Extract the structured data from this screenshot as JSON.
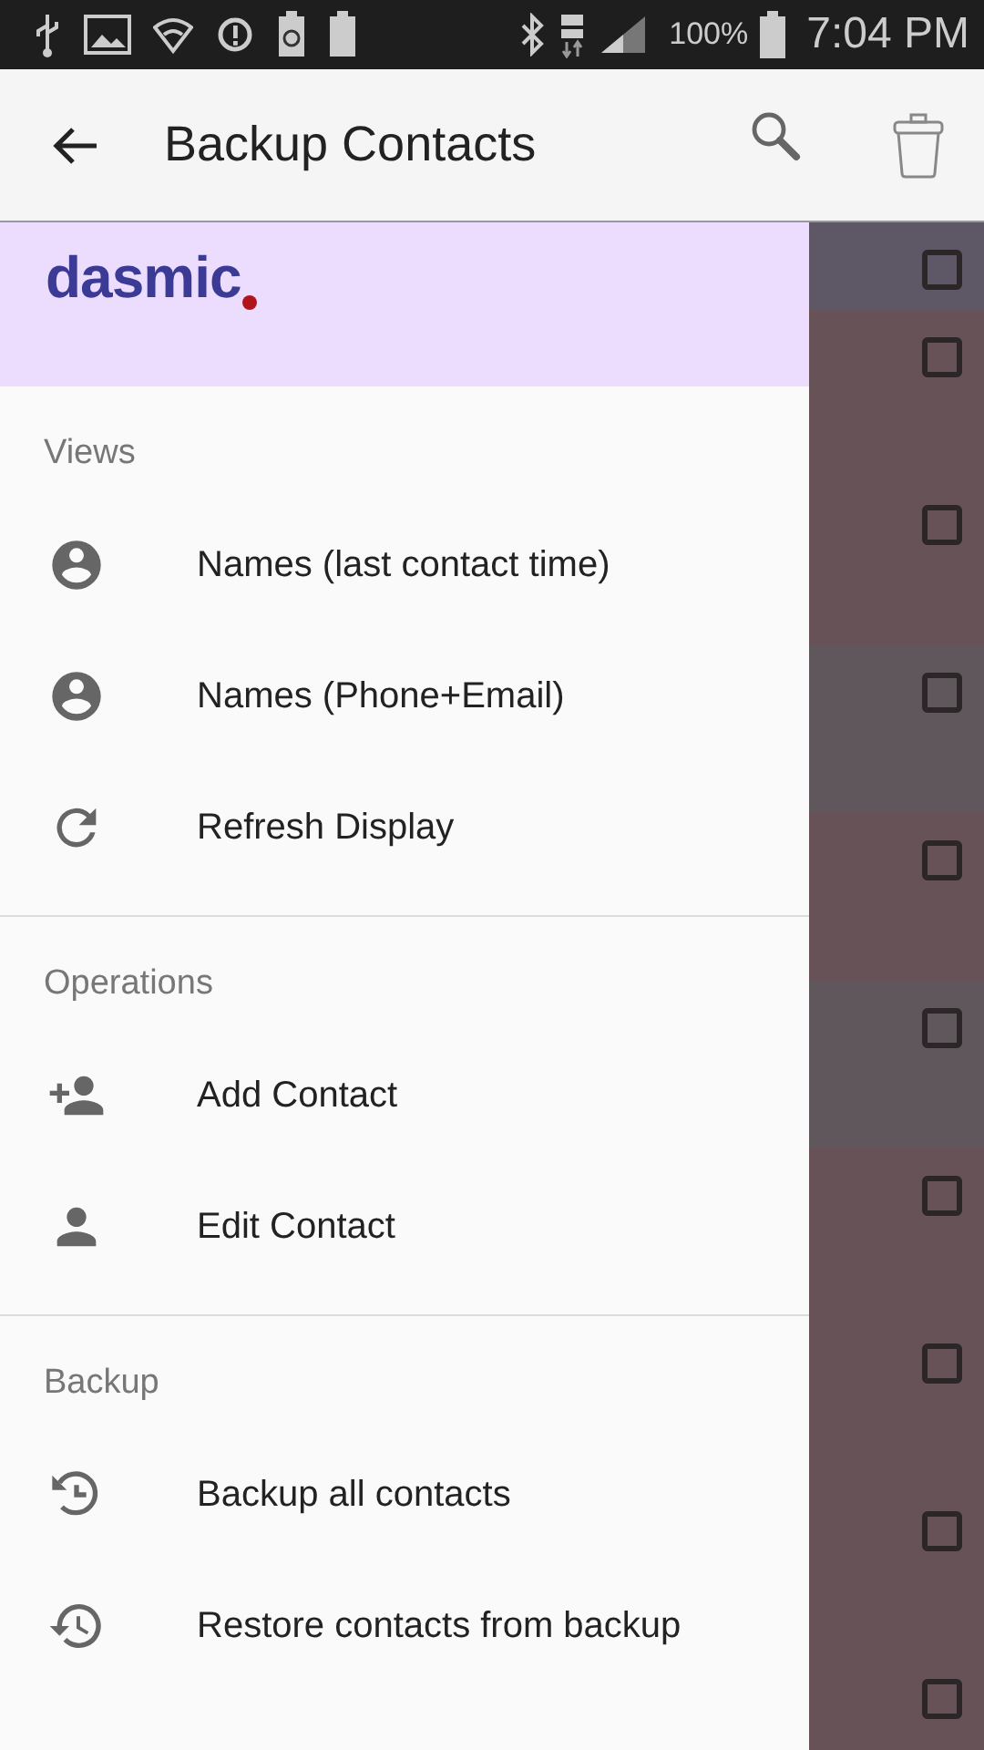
{
  "status_bar": {
    "battery": "100%",
    "time": "7:04 PM"
  },
  "toolbar": {
    "title": "Backup Contacts"
  },
  "drawer": {
    "logo": "dasmic",
    "sections": [
      {
        "title": "Views",
        "items": [
          {
            "label": "Names (last contact time)",
            "kind": "person-circle"
          },
          {
            "label": "Names (Phone+Email)",
            "kind": "person-circle"
          },
          {
            "label": "Refresh Display",
            "kind": "refresh"
          }
        ]
      },
      {
        "title": "Operations",
        "items": [
          {
            "label": "Add Contact",
            "kind": "person-add"
          },
          {
            "label": "Edit Contact",
            "kind": "person"
          }
        ]
      },
      {
        "title": "Backup",
        "items": [
          {
            "label": "Backup all contacts",
            "kind": "backup"
          },
          {
            "label": "Restore contacts from backup",
            "kind": "restore"
          }
        ]
      }
    ]
  },
  "list_rows": [
    {
      "checked": false,
      "color": "#5d5766"
    },
    {
      "checked": false,
      "color": "#675357"
    },
    {
      "checked": false,
      "color": "#675357"
    },
    {
      "checked": false,
      "color": "#5f575b"
    },
    {
      "checked": false,
      "color": "#675357"
    },
    {
      "checked": false,
      "color": "#5f575b"
    },
    {
      "checked": false,
      "color": "#675357"
    },
    {
      "checked": false,
      "color": "#675357"
    },
    {
      "checked": false,
      "color": "#675357"
    },
    {
      "checked": false,
      "color": "#675357"
    }
  ]
}
